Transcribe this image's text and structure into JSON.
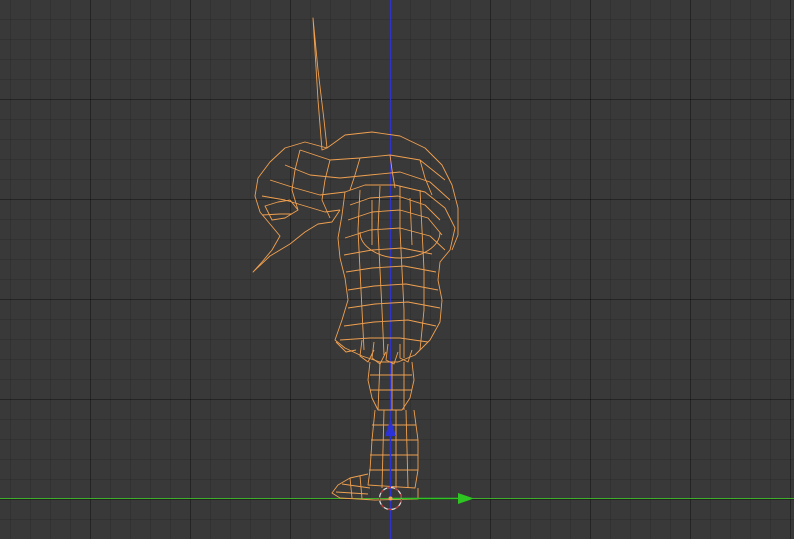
{
  "viewport": {
    "background_color": "#393939",
    "grid_color": "#2f2f2f"
  },
  "axes": {
    "x_axis_color": "#3fae2a",
    "z_axis_color": "#2f33c8"
  },
  "object": {
    "wire_color": "#f0a050",
    "icon": "wireframe-mesh"
  },
  "gizmo": {
    "x_arrow_color": "#2ec422",
    "z_arrow_color": "#2a32d8",
    "origin_icon": "3d-cursor-icon"
  }
}
